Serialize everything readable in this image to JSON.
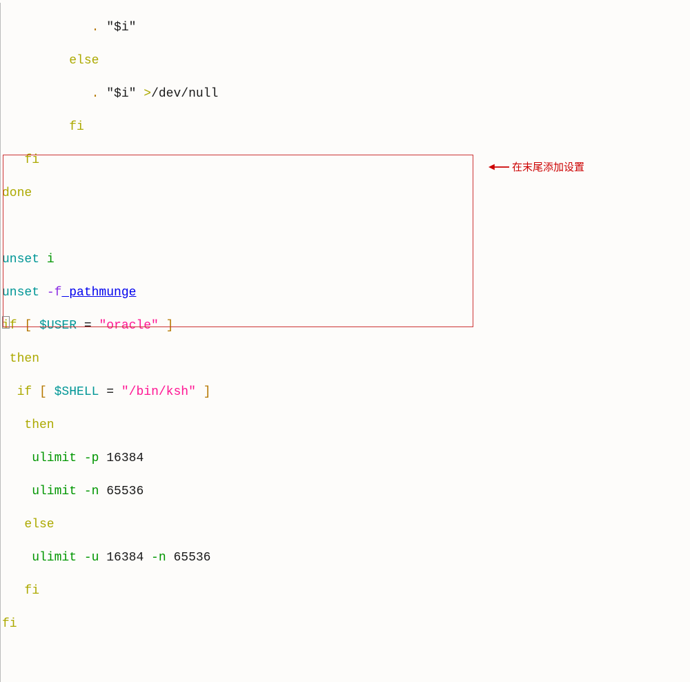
{
  "code": {
    "l1a": "            . ",
    "l1b": "\"$i\"",
    "l2": "         else",
    "l3a": "            . ",
    "l3b": "\"$i\"",
    "l3c": " >",
    "l3d": "/dev/null",
    "l4": "         fi",
    "l5": "   fi",
    "l6": "done",
    "l7": " ",
    "l8a": "unset",
    "l8b": " i",
    "l9a": "unset",
    "l9b": " -f",
    "l9c": " pathmunge",
    "l10a": "if",
    "l10b": " [",
    "l10c": " $USER",
    "l10d": " = ",
    "l10e": "\"oracle\"",
    "l10f": " ]",
    "l11": " then",
    "l12a": "  if",
    "l12b": " [",
    "l12c": " $SHELL",
    "l12d": " = ",
    "l12e": "\"/bin/ksh\"",
    "l12f": " ]",
    "l13": "   then",
    "l14a": "    ulimit -p ",
    "l14b": "16384",
    "l15a": "    ulimit -n ",
    "l15b": "65536",
    "l16": "   else",
    "l17a": "    ulimit -u ",
    "l17b": "16384",
    "l17c": " -n ",
    "l17d": "65536",
    "l18": "   fi",
    "l19": "fi",
    "l20": " "
  },
  "annotation": {
    "text": "在末尾添加设置"
  }
}
